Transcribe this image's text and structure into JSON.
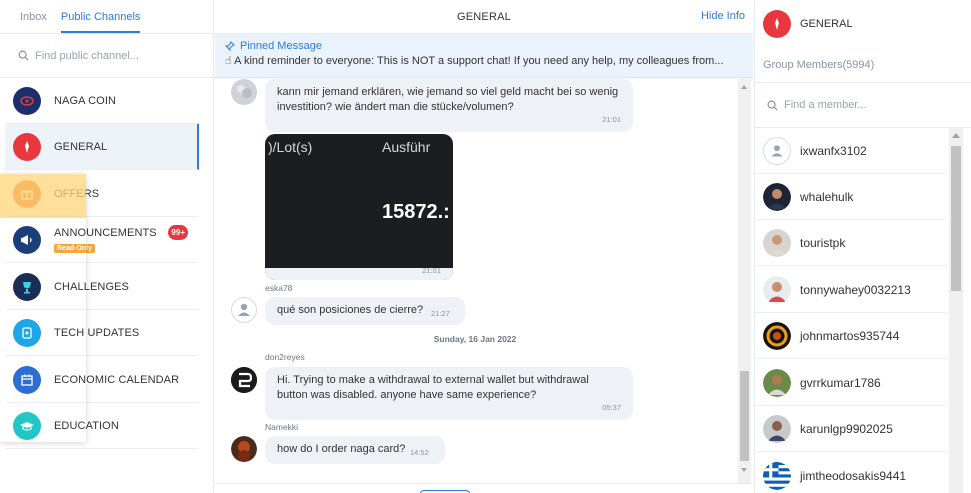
{
  "left": {
    "tabs": [
      "Inbox",
      "Public Channels"
    ],
    "search_placeholder": "Find public channel...",
    "channels": [
      {
        "name": "NAGA COIN",
        "color": "#1c2f6b"
      },
      {
        "name": "GENERAL",
        "color": "#e8383d"
      },
      {
        "name": "OFFERS",
        "color": "#f06a2a"
      },
      {
        "name": "ANNOUNCEMENTS",
        "color": "#1c3f7a",
        "badge": "99+",
        "tag": "Read-Only"
      },
      {
        "name": "CHALLENGES",
        "color": "#1a2e55"
      },
      {
        "name": "TECH UPDATES",
        "color": "#1fa6e8"
      },
      {
        "name": "ECONOMIC CALENDAR",
        "color": "#2d6fd1"
      },
      {
        "name": "EDUCATION",
        "color": "#22c6c6"
      }
    ]
  },
  "center": {
    "title": "GENERAL",
    "hide_info": "Hide Info",
    "pinned": {
      "label": "Pinned Message",
      "text": "A kind reminder to everyone: This is NOT a support chat! If you need any help, my colleagues from..."
    },
    "messages": [
      {
        "text": "kann mir jemand erklären, wie jemand so viel geld macht bei so wenig investition? wie ändert man die stücke/volumen?",
        "time": "21:01"
      },
      {
        "image_texts": [
          ")/Lot(s)",
          "Ausführ",
          "15872.:"
        ],
        "time": "21:01"
      },
      {
        "sender": "eska78",
        "text": "qué son posiciones de cierre?",
        "time": "21:27"
      },
      {
        "date": "Sunday, 16 Jan 2022"
      },
      {
        "sender": "don2reyes",
        "text": "Hi. Trying to make a withdrawal to external wallet but withdrawal button was disabled. anyone have same experience?",
        "time": "05:37"
      },
      {
        "sender": "Namekki",
        "text": "how do I order naga card?",
        "time": "14:52"
      }
    ]
  },
  "right": {
    "group_name": "GENERAL",
    "members_label": "Group Members(5994)",
    "search_placeholder": "Find a member...",
    "members": [
      "ixwanfx3102",
      "whalehulk",
      "touristpk",
      "tonnywahey0032213",
      "johnmartos935744",
      "gvrrkumar1786",
      "karunlgp9902025",
      "jimtheodosakis9441"
    ]
  },
  "colors": {
    "accent": "#2b7be0",
    "badge": "#e8383d",
    "readonly": "#f7a735"
  }
}
